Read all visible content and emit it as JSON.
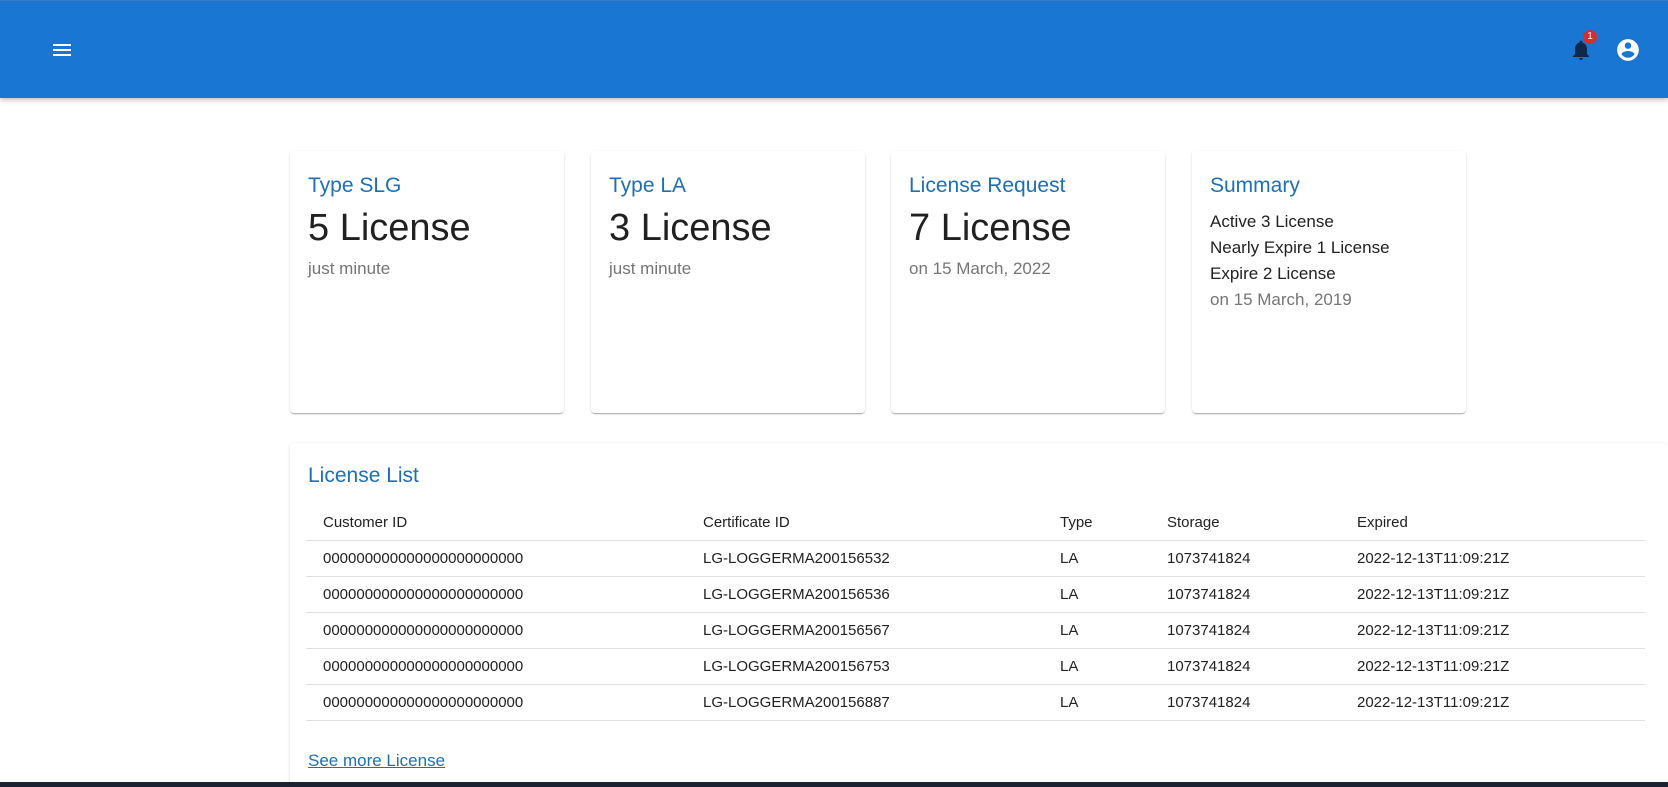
{
  "appbar": {
    "menu_icon": "hamburger-menu-icon",
    "notifications_icon": "bell-icon",
    "notification_count": "1",
    "account_icon": "account-circle-icon",
    "color": "#1976d2"
  },
  "cards": [
    {
      "title": "Type SLG",
      "value": "5 License",
      "subtitle": "just minute"
    },
    {
      "title": "Type LA",
      "value": "3 License",
      "subtitle": "just minute"
    },
    {
      "title": "License Request",
      "value": "7 License",
      "subtitle": "on 15 March, 2022"
    }
  ],
  "summary": {
    "title": "Summary",
    "lines": [
      "Active 3 License",
      "Nearly Expire 1 License",
      "Expire 2 License"
    ],
    "subtitle": "on 15 March, 2019"
  },
  "license_list": {
    "title": "License List",
    "columns": [
      "Customer ID",
      "Certificate ID",
      "Type",
      "Storage",
      "Expired"
    ],
    "rows": [
      [
        "000000000000000000000000",
        "LG-LOGGERMA200156532",
        "LA",
        "1073741824",
        "2022-12-13T11:09:21Z"
      ],
      [
        "000000000000000000000000",
        "LG-LOGGERMA200156536",
        "LA",
        "1073741824",
        "2022-12-13T11:09:21Z"
      ],
      [
        "000000000000000000000000",
        "LG-LOGGERMA200156567",
        "LA",
        "1073741824",
        "2022-12-13T11:09:21Z"
      ],
      [
        "000000000000000000000000",
        "LG-LOGGERMA200156753",
        "LA",
        "1073741824",
        "2022-12-13T11:09:21Z"
      ],
      [
        "000000000000000000000000",
        "LG-LOGGERMA200156887",
        "LA",
        "1073741824",
        "2022-12-13T11:09:21Z"
      ]
    ],
    "see_more_label": "See more License"
  }
}
